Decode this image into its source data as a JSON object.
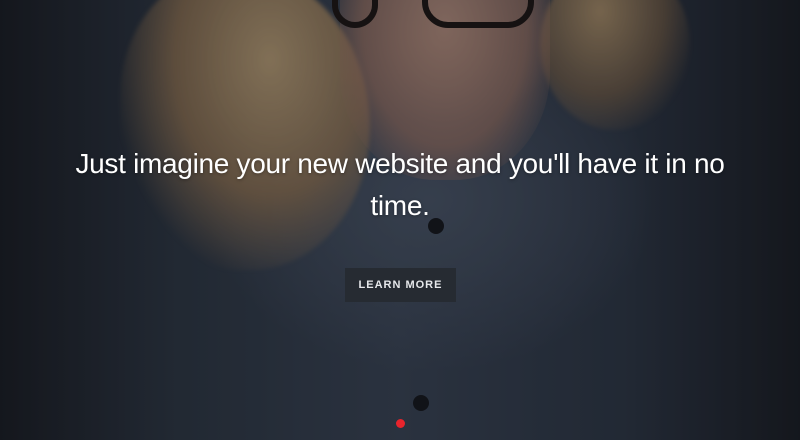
{
  "hero": {
    "headline": "Just imagine your new website and you'll have it in no time.",
    "button_label": "LEARN MORE"
  },
  "slider": {
    "slide_count": 1,
    "active_index": 0,
    "active_color": "#e8242c"
  },
  "colors": {
    "overlay": "#0a0d12",
    "button_bg": "#262b32",
    "text": "#ffffff"
  }
}
